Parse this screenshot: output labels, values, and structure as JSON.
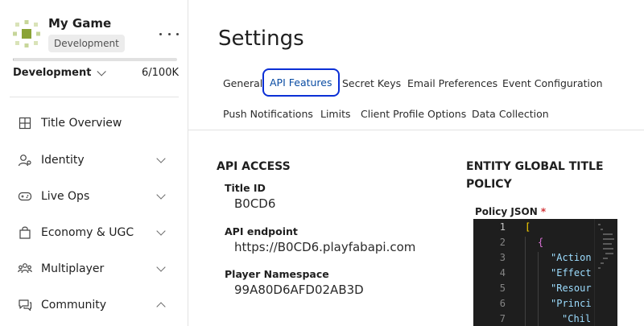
{
  "sidebar": {
    "game_name": "My Game",
    "game_env_badge": "Development",
    "environment": "Development",
    "usage": "6/100K",
    "usage_fraction": 6e-05,
    "items": [
      {
        "label": "Title Overview",
        "icon": "grid-icon",
        "expandable": false
      },
      {
        "label": "Identity",
        "icon": "identity-icon",
        "expandable": true,
        "expanded": false
      },
      {
        "label": "Live Ops",
        "icon": "gamepad-icon",
        "expandable": true,
        "expanded": false
      },
      {
        "label": "Economy & UGC",
        "icon": "economy-icon",
        "expandable": true,
        "expanded": false
      },
      {
        "label": "Multiplayer",
        "icon": "multiplayer-icon",
        "expandable": true,
        "expanded": false
      },
      {
        "label": "Community",
        "icon": "community-icon",
        "expandable": true,
        "expanded": true
      }
    ]
  },
  "main": {
    "title": "Settings",
    "tabs": [
      {
        "label": "General"
      },
      {
        "label": "API Features",
        "active": true
      },
      {
        "label": "Secret Keys"
      },
      {
        "label": "Email Preferences"
      },
      {
        "label": "Event Configuration"
      },
      {
        "label": "Push Notifications"
      },
      {
        "label": "Limits"
      },
      {
        "label": "Client Profile Options"
      },
      {
        "label": "Data Collection"
      }
    ],
    "api_access": {
      "heading": "API ACCESS",
      "title_id_label": "Title ID",
      "title_id": "B0CD6",
      "endpoint_label": "API endpoint",
      "endpoint": "https://B0CD6.playfabapi.com",
      "namespace_label": "Player Namespace",
      "namespace": "99A80D6AFD02AB3D"
    },
    "policy": {
      "heading": "ENTITY GLOBAL TITLE POLICY",
      "json_label": "Policy JSON",
      "required_mark": "*",
      "line_numbers": [
        "1",
        "2",
        "3",
        "4",
        "5",
        "6",
        "7"
      ],
      "lines": [
        {
          "open": "["
        },
        {
          "open": "{"
        },
        {
          "key": "\"Action"
        },
        {
          "key": "\"Effect"
        },
        {
          "key": "\"Resour"
        },
        {
          "key": "\"Princi"
        },
        {
          "key": "\"Chil"
        }
      ]
    }
  },
  "colors": {
    "active_tab_border": "#0b2fd6",
    "active_tab_text": "#0a4ca3",
    "required": "#d13438",
    "editor_bg": "#1e1e1e",
    "logo_green": "#8aa336"
  }
}
